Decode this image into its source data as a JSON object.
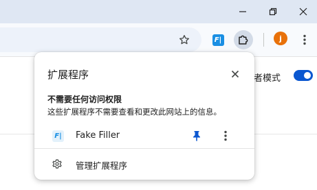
{
  "titlebar": {
    "minimize_icon": "minimize-icon",
    "restore_icon": "restore-icon",
    "close_icon": "close-icon"
  },
  "toolbar": {
    "bookmark_icon": "star-icon",
    "extension_icon": "fake-filler-logo",
    "extensions_menu_icon": "puzzle-icon",
    "avatar_letter": "j",
    "menu_icon": "vertical-dots-icon"
  },
  "page": {
    "developer_mode_label": "者模式",
    "developer_mode_on": true
  },
  "popup": {
    "title": "扩展程序",
    "section_heading": "不需要任何访问权限",
    "section_description": "这些扩展程序不需要查看和更改此网站上的信息。",
    "extensions": [
      {
        "logo_text": "F|",
        "name": "Fake Filler",
        "pinned": true
      }
    ],
    "manage_label": "管理扩展程序"
  },
  "colors": {
    "accent": "#0b57d0",
    "titlebar_bg": "#dfe7f3",
    "avatar_bg": "#e8710a",
    "ext_logo": "#1a8fe3"
  }
}
